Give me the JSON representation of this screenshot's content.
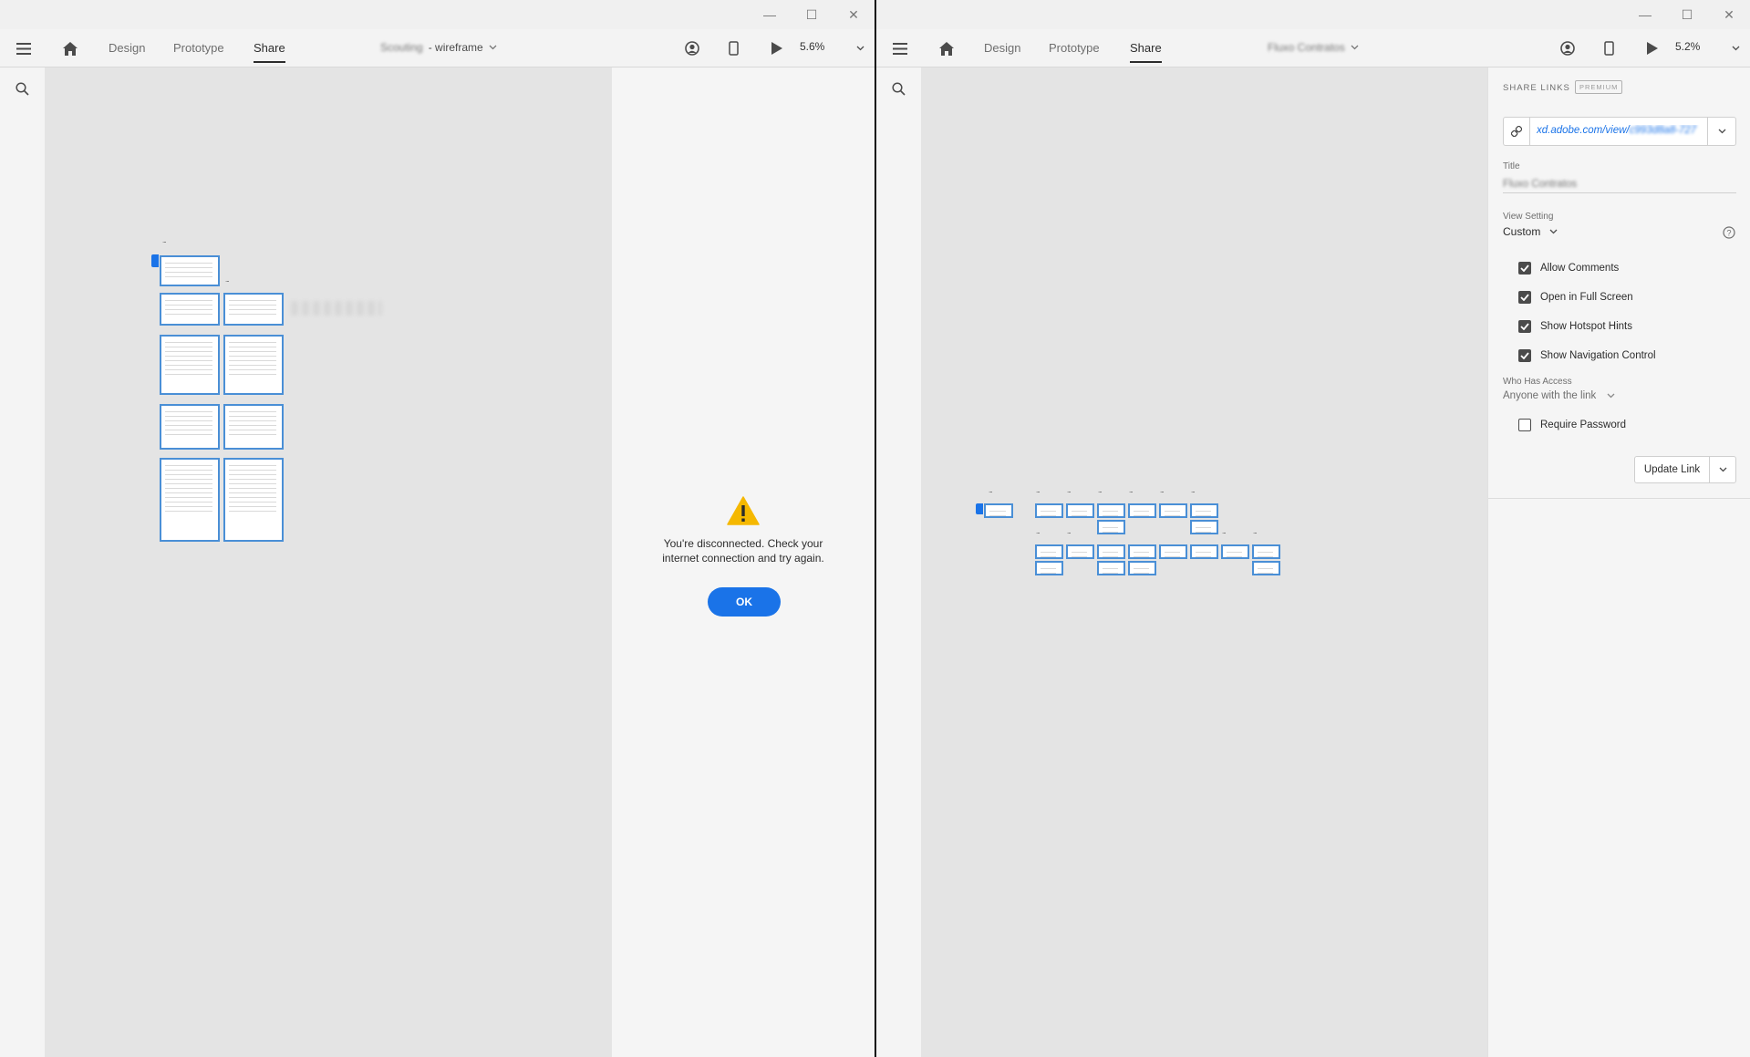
{
  "window_controls": {
    "minimize": "—",
    "maximize": "☐",
    "close": "✕"
  },
  "left_window": {
    "tabs": [
      "Design",
      "Prototype",
      "Share"
    ],
    "active_tab": "Share",
    "doc_title_blurred": "Scouting",
    "doc_title_suffix": "- wireframe",
    "zoom": "5.6%",
    "artboard_label": "...",
    "dialog": {
      "message_line1": "You're disconnected. Check your",
      "message_line2": "internet connection and try again.",
      "ok_label": "OK"
    }
  },
  "right_window": {
    "tabs": [
      "Design",
      "Prototype",
      "Share"
    ],
    "active_tab": "Share",
    "doc_title_blurred": "Fluxo Contratos",
    "zoom": "5.2%",
    "artboard_label": "...",
    "share_panel": {
      "header": "SHARE LINKS",
      "badge": "PREMIUM",
      "link_prefix": "xd.adobe.com/view/",
      "link_blurred": "c993d8a8-727",
      "title_label": "Title",
      "title_value_blurred": "Fluxo Contratos",
      "view_setting_label": "View Setting",
      "view_setting_value": "Custom",
      "options": [
        {
          "label": "Allow Comments",
          "checked": true
        },
        {
          "label": "Open in Full Screen",
          "checked": true
        },
        {
          "label": "Show Hotspot Hints",
          "checked": true
        },
        {
          "label": "Show Navigation Control",
          "checked": true
        }
      ],
      "who_has_access_label": "Who Has Access",
      "who_has_access_value": "Anyone with the link",
      "require_password_label": "Require Password",
      "require_password_checked": false,
      "update_button": "Update Link"
    }
  },
  "colors": {
    "accent": "#1a73e8",
    "artboard_border": "#4a8fd6",
    "warning": "#f5b800"
  }
}
